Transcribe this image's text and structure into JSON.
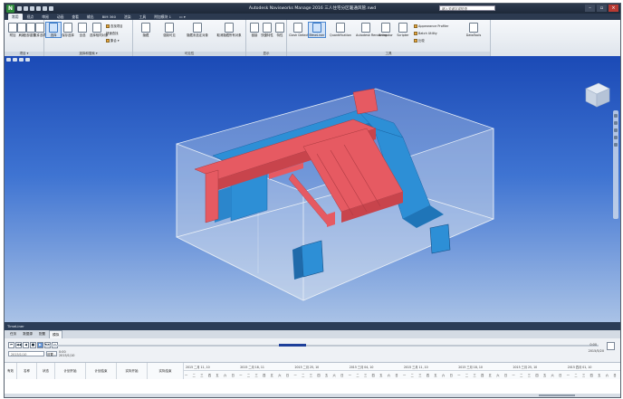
{
  "app": {
    "title": "Autodesk Navisworks Manage 2016    三人住宅分区暖通风管.nwd",
    "search_placeholder": "键入关键字或短语",
    "logo_letter": "N"
  },
  "ribbon": {
    "tabs": [
      "常用",
      "视点",
      "审阅",
      "动画",
      "查看",
      "输出",
      "BIM 360",
      "渲染",
      "工具",
      "附加模块 1",
      "▭ ▾"
    ],
    "active_tab": "常用",
    "groups": {
      "project_label": "项目 ▾",
      "select_label": "选择和搜索 ▾",
      "visibility_label": "可见性",
      "display_label": "显示",
      "tools_label": "工具"
    },
    "project_buttons": [
      "附加",
      "刷新",
      "全部重置...",
      "文件选项"
    ],
    "select_buttons": [
      "选择",
      "保存选择",
      "全选",
      "选择相同对象",
      "选择树"
    ],
    "select_small": [
      "查找项目",
      "快速查找",
      "集合 ▾"
    ],
    "visibility_buttons": [
      "隐藏",
      "强制可见",
      "隐藏未选定对象",
      "取消隐藏所有对象"
    ],
    "display_buttons": [
      "链接",
      "快捷特性",
      "特性"
    ],
    "tool_buttons": [
      "Clash Detective",
      "TimeLiner",
      "Quantification",
      "Autodesk Rendering",
      "Animator",
      "Scripter",
      "DataTools"
    ],
    "tool_small": [
      "Appearance Profiler",
      "Batch Utility",
      "比较"
    ],
    "selected_tool": "TimeLiner"
  },
  "viewport": {
    "icons": [
      "view-cube-icon",
      "navigation-bar-icon"
    ]
  },
  "timeliner": {
    "panel_title": "TimeLiner",
    "tabs": [
      "任务",
      "数据源",
      "配置",
      "模拟"
    ],
    "active_tab": "模拟",
    "controls": [
      "⏮",
      "◀◀",
      "◀",
      "■",
      "▶",
      "▶▶",
      "⏭"
    ],
    "progress_fraction": 0.44,
    "start_date": "2015/1/10",
    "start_time": "0:00",
    "end_time": "0:00",
    "end_date": "2015/5/20",
    "date_field": "2015/1/10",
    "mode_button": "设置...",
    "current_time": "0:00\n2015/1/10",
    "task_columns": [
      "有效",
      "名称",
      "状态",
      "计划开始",
      "计划结束",
      "实际开始",
      "实际结束"
    ],
    "gantt_months": [
      "2015 二月 11, 10",
      "2015 二月 18, 11",
      "2015 二月 25, 10",
      "2015 三月 04, 10",
      "2015 三月 11, 10",
      "2015 三月 18, 10",
      "2015 三月 25, 10",
      "2015 四月 01, 10"
    ],
    "gantt_days": [
      "一",
      "二",
      "三",
      "四",
      "五",
      "六",
      "日"
    ]
  },
  "colors": {
    "duct_red": "#e65a62",
    "duct_blue": "#2d8fd6",
    "room_glass": "#d2dcea",
    "viewport_top": "#1b4ab6",
    "viewport_bottom": "#a9c2e6"
  }
}
